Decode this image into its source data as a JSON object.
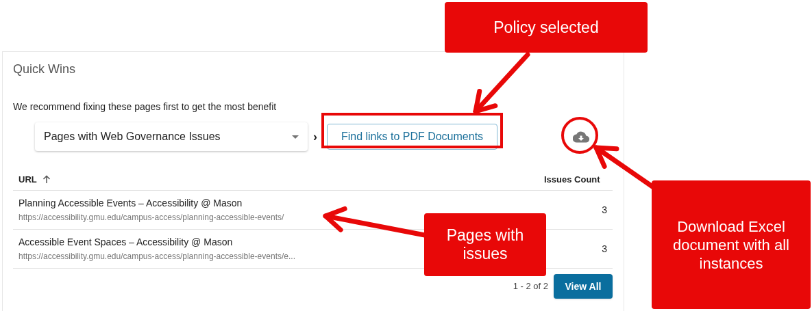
{
  "card": {
    "title": "Quick Wins",
    "subtitle": "We recommend fixing these pages first to get the most benefit",
    "category_select": {
      "value": "Pages with Web Governance Issues"
    },
    "separator": "›",
    "policy_button": {
      "label": "Find links to PDF Documents"
    }
  },
  "table": {
    "columns": [
      {
        "label": "URL",
        "sorted": true
      },
      {
        "label": "Issues Count",
        "sorted": false
      }
    ],
    "rows": [
      {
        "title": "Planning Accessible Events – Accessibility @ Mason",
        "url": "https://accessibility.gmu.edu/campus-access/planning-accessible-events/",
        "count": "3"
      },
      {
        "title": "Accessible Event Spaces – Accessibility @ Mason",
        "url": "https://accessibility.gmu.edu/campus-access/planning-accessible-events/e...",
        "count": "3"
      }
    ]
  },
  "pagination": "1 - 2 of 2",
  "view_all_button": "View All",
  "callouts": [
    {
      "text": "Policy selected"
    },
    {
      "text": "Pages with issues"
    },
    {
      "text": "Download Excel document with all instances"
    }
  ]
}
